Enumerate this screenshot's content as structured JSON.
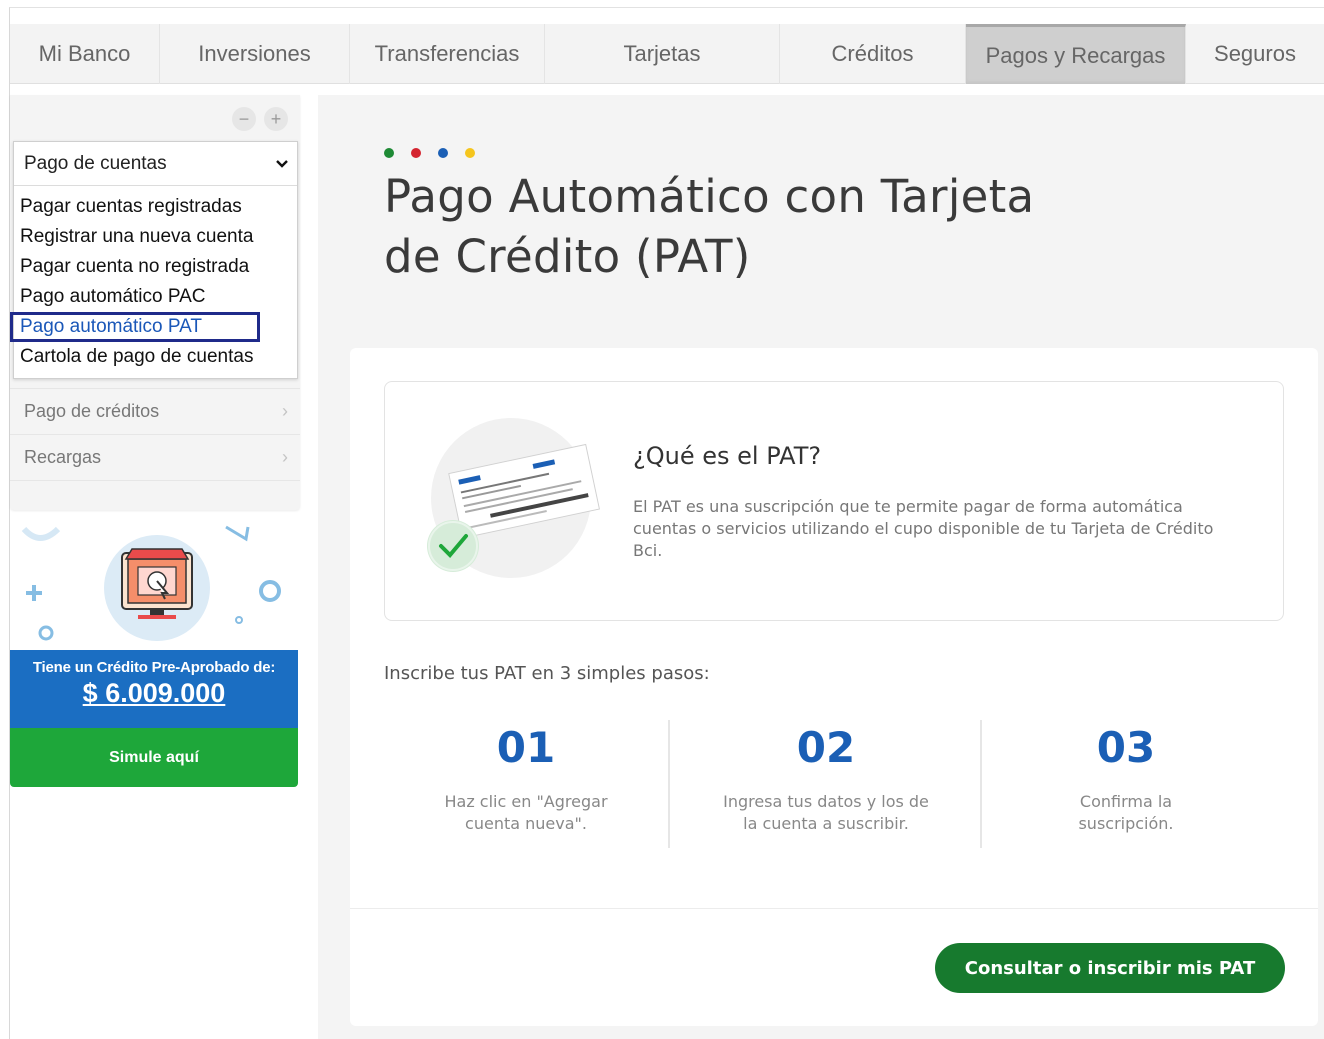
{
  "topnav": {
    "tabs": [
      {
        "label": "Mi Banco"
      },
      {
        "label": "Inversiones"
      },
      {
        "label": "Transferencias"
      },
      {
        "label": "Tarjetas"
      },
      {
        "label": "Créditos"
      },
      {
        "label": "Pagos y Recargas",
        "active": true
      },
      {
        "label": "Seguros"
      }
    ]
  },
  "sidebar": {
    "zoom_out": "−",
    "zoom_in": "+",
    "dropdown": {
      "selected": "Pago de cuentas",
      "options": [
        "Pagar cuentas registradas",
        "Registrar una nueva cuenta",
        "Pagar cuenta no registrada",
        "Pago automático PAC",
        "Pago automático PAT",
        "Cartola de pago de cuentas"
      ],
      "highlighted": "Pago automático PAT"
    },
    "rows": [
      {
        "label": "Pago de créditos"
      },
      {
        "label": "Recargas"
      }
    ]
  },
  "promo": {
    "label": "Tiene un Crédito Pre-Aprobado de:",
    "amount": "$ 6.009.000",
    "button": "Simule aquí"
  },
  "main": {
    "dot_colors": [
      "#1e8a35",
      "#d4242f",
      "#1b5fb5",
      "#f5c51d"
    ],
    "title_line1": "Pago Automático con Tarjeta",
    "title_line2": "de Crédito (PAT)",
    "info": {
      "title": "¿Qué es el PAT?",
      "text": "El PAT es una suscripción que te permite pagar de forma automática cuentas o servicios utilizando el cupo disponible de tu Tarjeta de Crédito Bci."
    },
    "steps_title": "Inscribe tus PAT en 3 simples pasos:",
    "steps": [
      {
        "num": "01",
        "line1": "Haz clic en \"Agregar",
        "line2": "cuenta nueva\"."
      },
      {
        "num": "02",
        "line1": "Ingresa tus datos y los de",
        "line2": "la cuenta a suscribir."
      },
      {
        "num": "03",
        "line1": "Confirma la",
        "line2": "suscripción."
      }
    ],
    "cta": "Consultar o inscribir mis PAT"
  },
  "colors": {
    "accent_blue": "#1b5fb5",
    "cta_green": "#177a2e",
    "promo_blue": "#1b6ec2",
    "promo_green": "#1ea73a"
  }
}
